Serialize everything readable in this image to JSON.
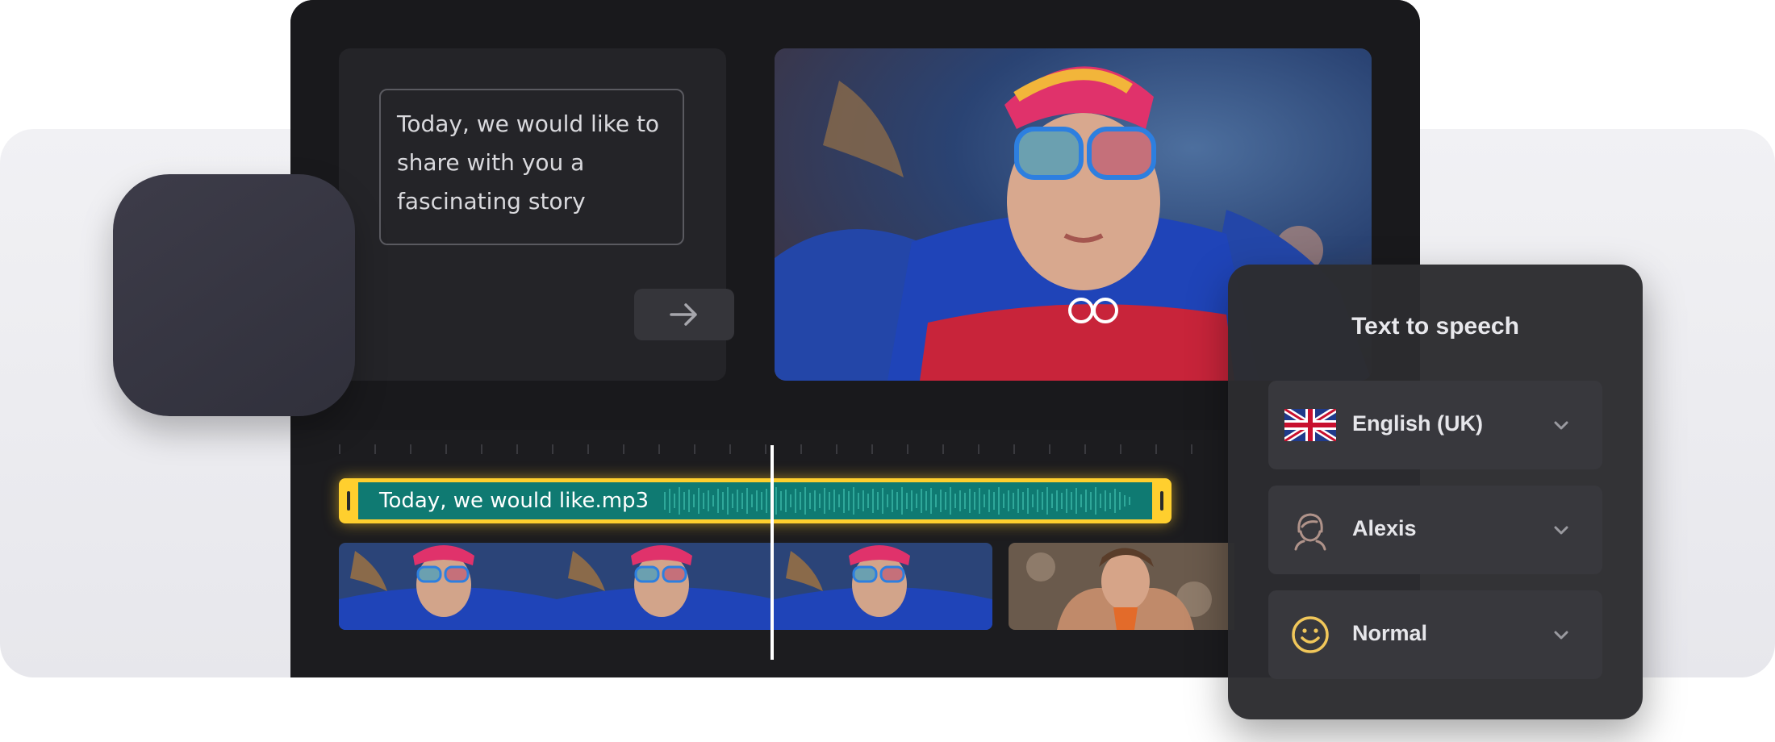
{
  "text_panel": {
    "input_value": "Today, we would like to share with you a fascinating story"
  },
  "timeline": {
    "audio_clip_label": "Today, we would like.mp3"
  },
  "tts": {
    "title": "Text to speech",
    "language": "English (UK)",
    "voice": "Alexis",
    "emotion": "Normal"
  },
  "colors": {
    "accent_clip_border": "#ffcf2e",
    "audio_clip_fill": "#0f7a72",
    "panel_bg": "#2c2c30",
    "editor_bg": "#1c1c1f"
  },
  "icons": {
    "app": "soundwave-icon",
    "submit": "arrow-right-icon",
    "language": "uk-flag-icon",
    "voice": "female-avatar-icon",
    "emotion": "smiley-icon",
    "dropdown": "chevron-down-icon"
  }
}
